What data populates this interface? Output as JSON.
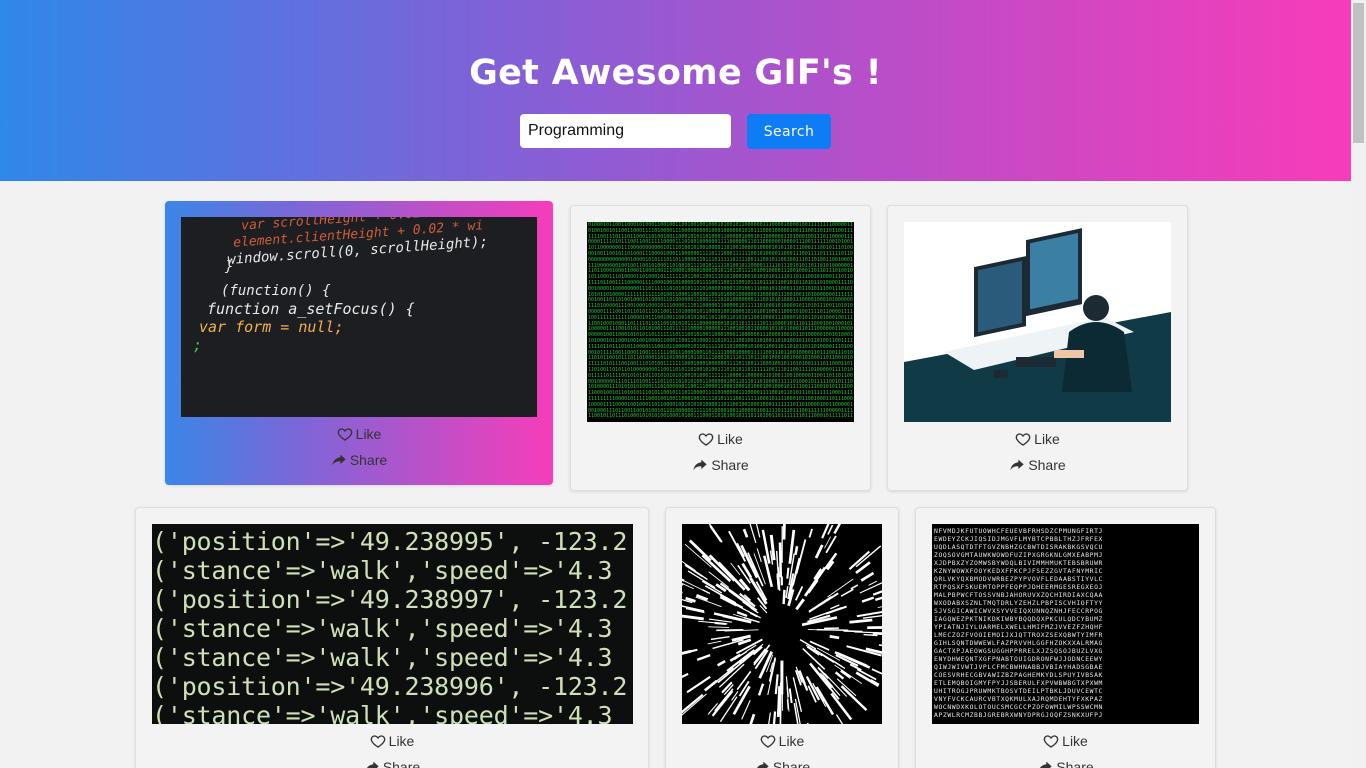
{
  "header": {
    "title": "Get Awesome GIF's !",
    "search_value": "Programming",
    "search_button": "Search"
  },
  "cards": [
    {
      "image": "code-editor-gif",
      "code_lines": [
        "var scrollHeight + 0.02 * wi",
        "element.clientHeight + 0.02 * wi",
        "window.scroll(0, scrollHeight);",
        "}",
        "(function() {",
        "function a_setFocus() {",
        "var form = null;",
        ";"
      ],
      "like": "Like",
      "share": "Share"
    },
    {
      "image": "binary-matrix-gif",
      "like": "Like",
      "share": "Share"
    },
    {
      "image": "developer-illustration-gif",
      "like": "Like",
      "share": "Share"
    },
    {
      "image": "ruby-console-gif",
      "code_lines": [
        "('position'=>'49.238995', -123.2",
        "('stance'=>'walk','speed'=>'4.3",
        "('position'=>'49.238997', -123.2",
        "('stance'=>'walk','speed'=>'4.3",
        "('stance'=>'walk','speed'=>'4.3",
        "('position'=>'49.238996', -123.2",
        "('stance'=>'walk','speed'=>'4.3"
      ],
      "like": "Like",
      "share": "Share"
    },
    {
      "image": "hyperspace-stars-gif",
      "like": "Like",
      "share": "Share"
    },
    {
      "image": "random-letters-gif",
      "like": "Like",
      "share": "Share"
    }
  ],
  "colors": {
    "header_gradient_start": "#2f88e9",
    "header_gradient_end": "#f83cb9",
    "button_blue": "#0d7cf5"
  }
}
